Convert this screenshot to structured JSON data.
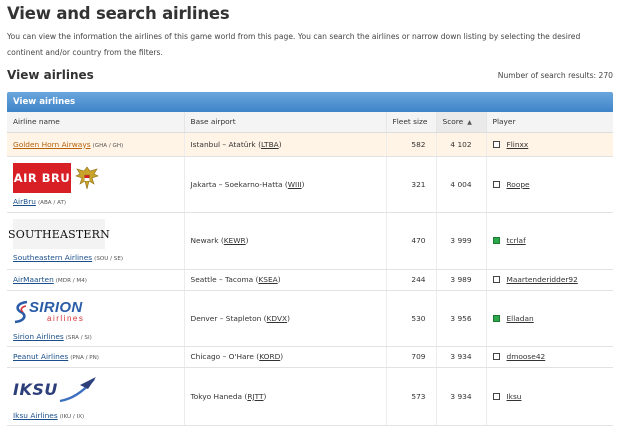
{
  "page": {
    "title": "View and search airlines",
    "intro": "You can view the information the airlines of this game world from this page. You can search the airlines or narrow down listing by selecting the desired continent and/or country from the filters.",
    "section_title": "View airlines",
    "results_label": "Number of search results: 270"
  },
  "table": {
    "header_bar": "View airlines",
    "columns": {
      "name": "Airline name",
      "base": "Base airport",
      "fleet": "Fleet size",
      "score": "Score",
      "player": "Player"
    },
    "sort_indicator": "▲",
    "rows": [
      {
        "name": "Golden Horn Airways",
        "codes": "(GHA / GH)",
        "base_city": "Istanbul – Atatürk (",
        "base_code": "LTBA",
        "fleet": "582",
        "score": "4 102",
        "player": "Flinxx",
        "online": false,
        "logo": ""
      },
      {
        "name": "AirBru",
        "codes": "(ABA / AT)",
        "base_city": "Jakarta – Soekarno-Hatta (",
        "base_code": "WIII",
        "fleet": "321",
        "score": "4 004",
        "player": "Roope",
        "online": false,
        "logo": "AIR BRU"
      },
      {
        "name": "Southeastern Airlines",
        "codes": "(SOU / SE)",
        "base_city": "Newark (",
        "base_code": "KEWR",
        "fleet": "470",
        "score": "3 999",
        "player": "tcrlaf",
        "online": true,
        "logo": "SOUTHEASTERN"
      },
      {
        "name": "AirMaarten",
        "codes": "(MDR / M4)",
        "base_city": "Seattle – Tacoma (",
        "base_code": "KSEA",
        "fleet": "244",
        "score": "3 989",
        "player": "Maartenderidder92",
        "online": false,
        "logo": ""
      },
      {
        "name": "Sirion Airlines",
        "codes": "(SRA / SI)",
        "base_city": "Denver – Stapleton (",
        "base_code": "KDVX",
        "fleet": "530",
        "score": "3 956",
        "player": "Elladan",
        "online": true,
        "logo": "SIRION",
        "logo_sub": "airlines"
      },
      {
        "name": "Peanut Airlines",
        "codes": "(PNA / PN)",
        "base_city": "Chicago – O'Hare (",
        "base_code": "KORD",
        "fleet": "709",
        "score": "3 934",
        "player": "dmoose42",
        "online": false,
        "logo": ""
      },
      {
        "name": "Iksu Airlines",
        "codes": "(IKU / IX)",
        "base_city": "Tokyo Haneda (",
        "base_code": "RJTT",
        "fleet": "573",
        "score": "3 934",
        "player": "Iksu",
        "online": false,
        "logo": "IKSU"
      }
    ]
  },
  "colors": {
    "header_bar": "#4a8fd0",
    "highlight_row": "#fff4e6",
    "online_status": "#2ca84a",
    "airbru_red": "#d91f26",
    "sirion_blue": "#2b5ca8",
    "sirion_red": "#d73236",
    "iksu_navy": "#2c3f7a"
  }
}
